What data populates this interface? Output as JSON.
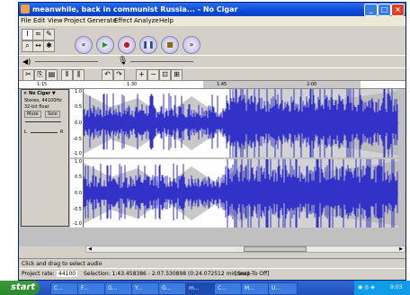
{
  "window": {
    "title": "meanwhile, back in communist Russia... - No Cigar"
  },
  "menu": [
    "File",
    "Edit",
    "View",
    "Project",
    "Generate",
    "Effect",
    "Analyze",
    "Help"
  ],
  "ruler": {
    "ticks": [
      "1:15",
      "1:30",
      "1:45",
      "2:00"
    ]
  },
  "track": {
    "name": "No Cigar",
    "info": "Stereo, 44100Hz",
    "format": "32-bit float",
    "mute_label": "Mute",
    "solo_label": "Solo",
    "left_label": "L",
    "right_label": "R",
    "scale_top": [
      "1.0",
      "0.5",
      "0.0",
      "-0.5",
      "-1.0"
    ],
    "scale_bottom": [
      "1.0",
      "0.5",
      "0.0",
      "-0.5",
      "-1.0"
    ]
  },
  "status": {
    "hint": "Click and drag to select audio",
    "project_rate_label": "Project rate:",
    "project_rate": "44100",
    "selection": "Selection: 1:43.458386 - 2:07.530898 (0:24.072512 min:sec)",
    "snap": "[Snap-To Off]"
  },
  "taskbar": {
    "start": "start",
    "tasks": [
      "C...",
      "F...",
      "G...",
      "Y...",
      "G...",
      "m...",
      "C...",
      "M...",
      "U..."
    ],
    "clock": "9:03"
  },
  "colors": {
    "wave": "#3232c8",
    "selection": "#b4b4b4",
    "titlebar": "#0a4ad6"
  }
}
